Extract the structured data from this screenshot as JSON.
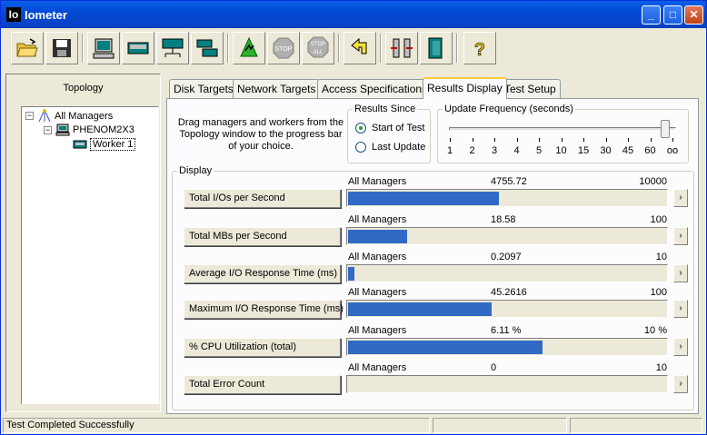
{
  "window": {
    "logo": "Io",
    "title": "Iometer",
    "minimize": "_",
    "maximize": "□",
    "close": "✕"
  },
  "toolbar": {
    "tools": [
      {
        "name": "open-config-icon"
      },
      {
        "name": "save-config-icon"
      },
      {
        "name": "start-new-manager-icon"
      },
      {
        "name": "start-disk-worker-icon"
      },
      {
        "name": "start-network-worker-icon"
      },
      {
        "name": "duplicate-worker-icon"
      },
      {
        "name": "start-tests-icon"
      },
      {
        "name": "stop-current-test-icon",
        "label": "STOP"
      },
      {
        "name": "stop-all-tests-icon",
        "label": "STOP ALL"
      },
      {
        "name": "reset-workers-icon"
      },
      {
        "name": "disconnect-manager-icon"
      },
      {
        "name": "exit-icon"
      },
      {
        "name": "help-icon",
        "label": "?"
      }
    ]
  },
  "topology": {
    "title": "Topology",
    "tree": {
      "root": "All Managers",
      "manager": "PHENOM2X3",
      "worker": "Worker 1"
    }
  },
  "tabs": [
    {
      "label": "Disk Targets",
      "active": false
    },
    {
      "label": "Network Targets",
      "active": false
    },
    {
      "label": "Access Specifications",
      "active": false
    },
    {
      "label": "Results Display",
      "active": true
    },
    {
      "label": "Test Setup",
      "active": false
    }
  ],
  "results": {
    "drag_text": "Drag managers and workers from the Topology window to the progress bar of your choice.",
    "results_since": {
      "label": "Results Since",
      "options": [
        "Start of Test",
        "Last Update"
      ],
      "selected": "Start of Test"
    },
    "update_frequency": {
      "label": "Update Frequency (seconds)",
      "ticks": [
        "1",
        "2",
        "3",
        "4",
        "5",
        "10",
        "15",
        "30",
        "45",
        "60",
        "oo"
      ],
      "selected": "oo"
    },
    "display_label": "Display",
    "metrics": [
      {
        "button": "Total I/Os per Second",
        "source": "All Managers",
        "value": "4755.72",
        "max": "10000",
        "fraction": 0.4756
      },
      {
        "button": "Total MBs per Second",
        "source": "All Managers",
        "value": "18.58",
        "max": "100",
        "fraction": 0.1858
      },
      {
        "button": "Average I/O Response Time (ms)",
        "source": "All Managers",
        "value": "0.2097",
        "max": "10",
        "fraction": 0.021
      },
      {
        "button": "Maximum I/O Response Time (ms)",
        "source": "All Managers",
        "value": "45.2616",
        "max": "100",
        "fraction": 0.4526
      },
      {
        "button": "% CPU Utilization (total)",
        "source": "All Managers",
        "value": "6.11 %",
        "max": "10 %",
        "fraction": 0.611
      },
      {
        "button": "Total Error Count",
        "source": "All Managers",
        "value": "0",
        "max": "10",
        "fraction": 0.0
      }
    ]
  },
  "statusbar": {
    "message": "Test Completed Successfully"
  },
  "colors": {
    "accent": "#316ac5",
    "titlebar": "#0349d5"
  }
}
